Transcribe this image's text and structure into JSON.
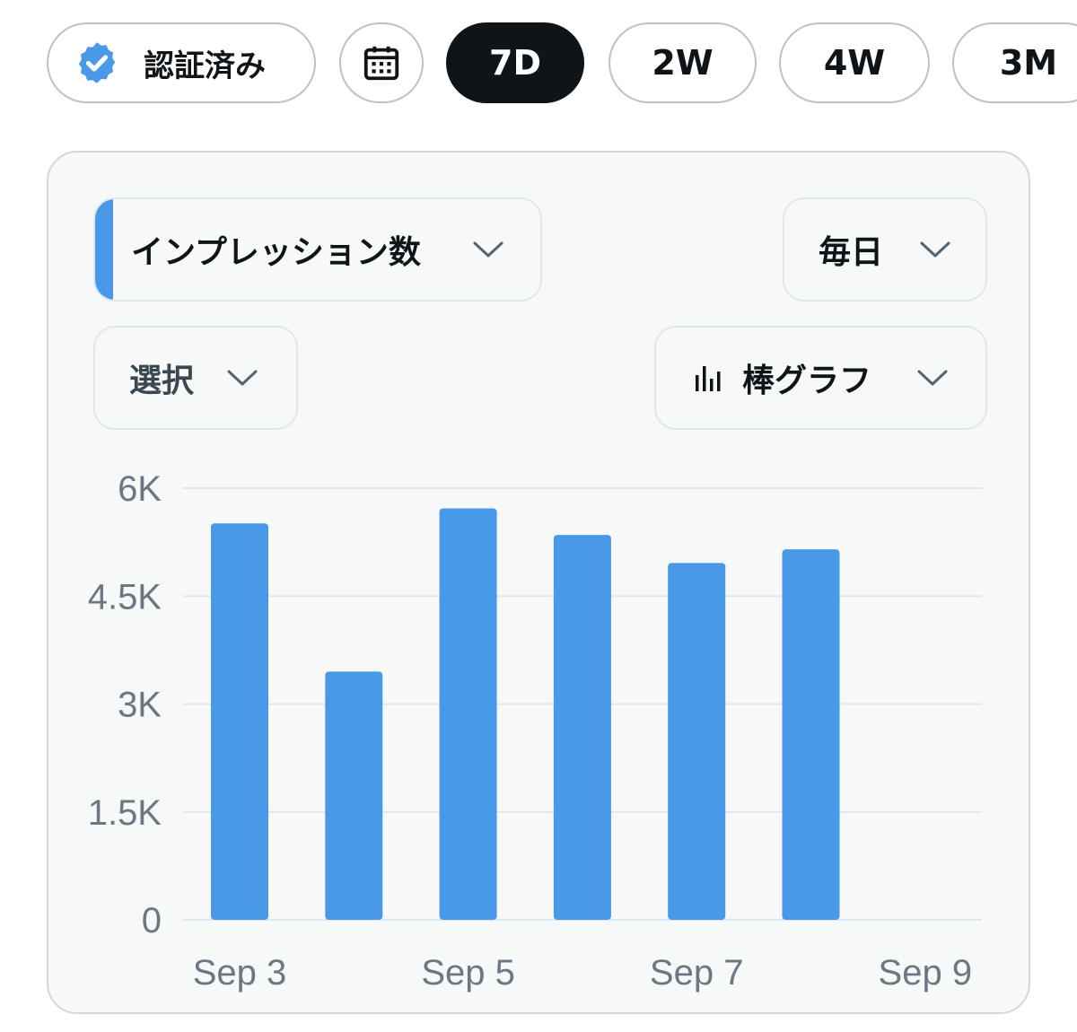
{
  "toolbar": {
    "verified_label": "認証済み",
    "ranges": [
      "7D",
      "2W",
      "4W",
      "3M"
    ],
    "active_range": "7D"
  },
  "controls": {
    "metric": "インプレッション数",
    "period": "毎日",
    "select": "選択",
    "chart_type": "棒グラフ"
  },
  "icons": {
    "verified": "verified-badge-icon",
    "calendar": "calendar-icon",
    "chevron": "chevron-down-icon",
    "bar_chart": "bar-chart-icon"
  },
  "colors": {
    "accent": "#4a99e9",
    "active_pill": "#0f1419",
    "card_bg": "#f7f9f9"
  },
  "chart_data": {
    "type": "bar",
    "categories": [
      "Sep 3",
      "Sep 4",
      "Sep 5",
      "Sep 6",
      "Sep 7",
      "Sep 8",
      "Sep 9"
    ],
    "values": [
      5510,
      3450,
      5720,
      5350,
      4960,
      5150,
      null
    ],
    "x_tick_labels": [
      "Sep 3",
      "Sep 5",
      "Sep 7",
      "Sep 9"
    ],
    "y_ticks": [
      0,
      1500,
      3000,
      4500,
      6000
    ],
    "y_tick_labels": [
      "0",
      "1.5K",
      "3K",
      "4.5K",
      "6K"
    ],
    "ylim": [
      0,
      6000
    ],
    "grid": true,
    "color": "#4a99e9"
  }
}
